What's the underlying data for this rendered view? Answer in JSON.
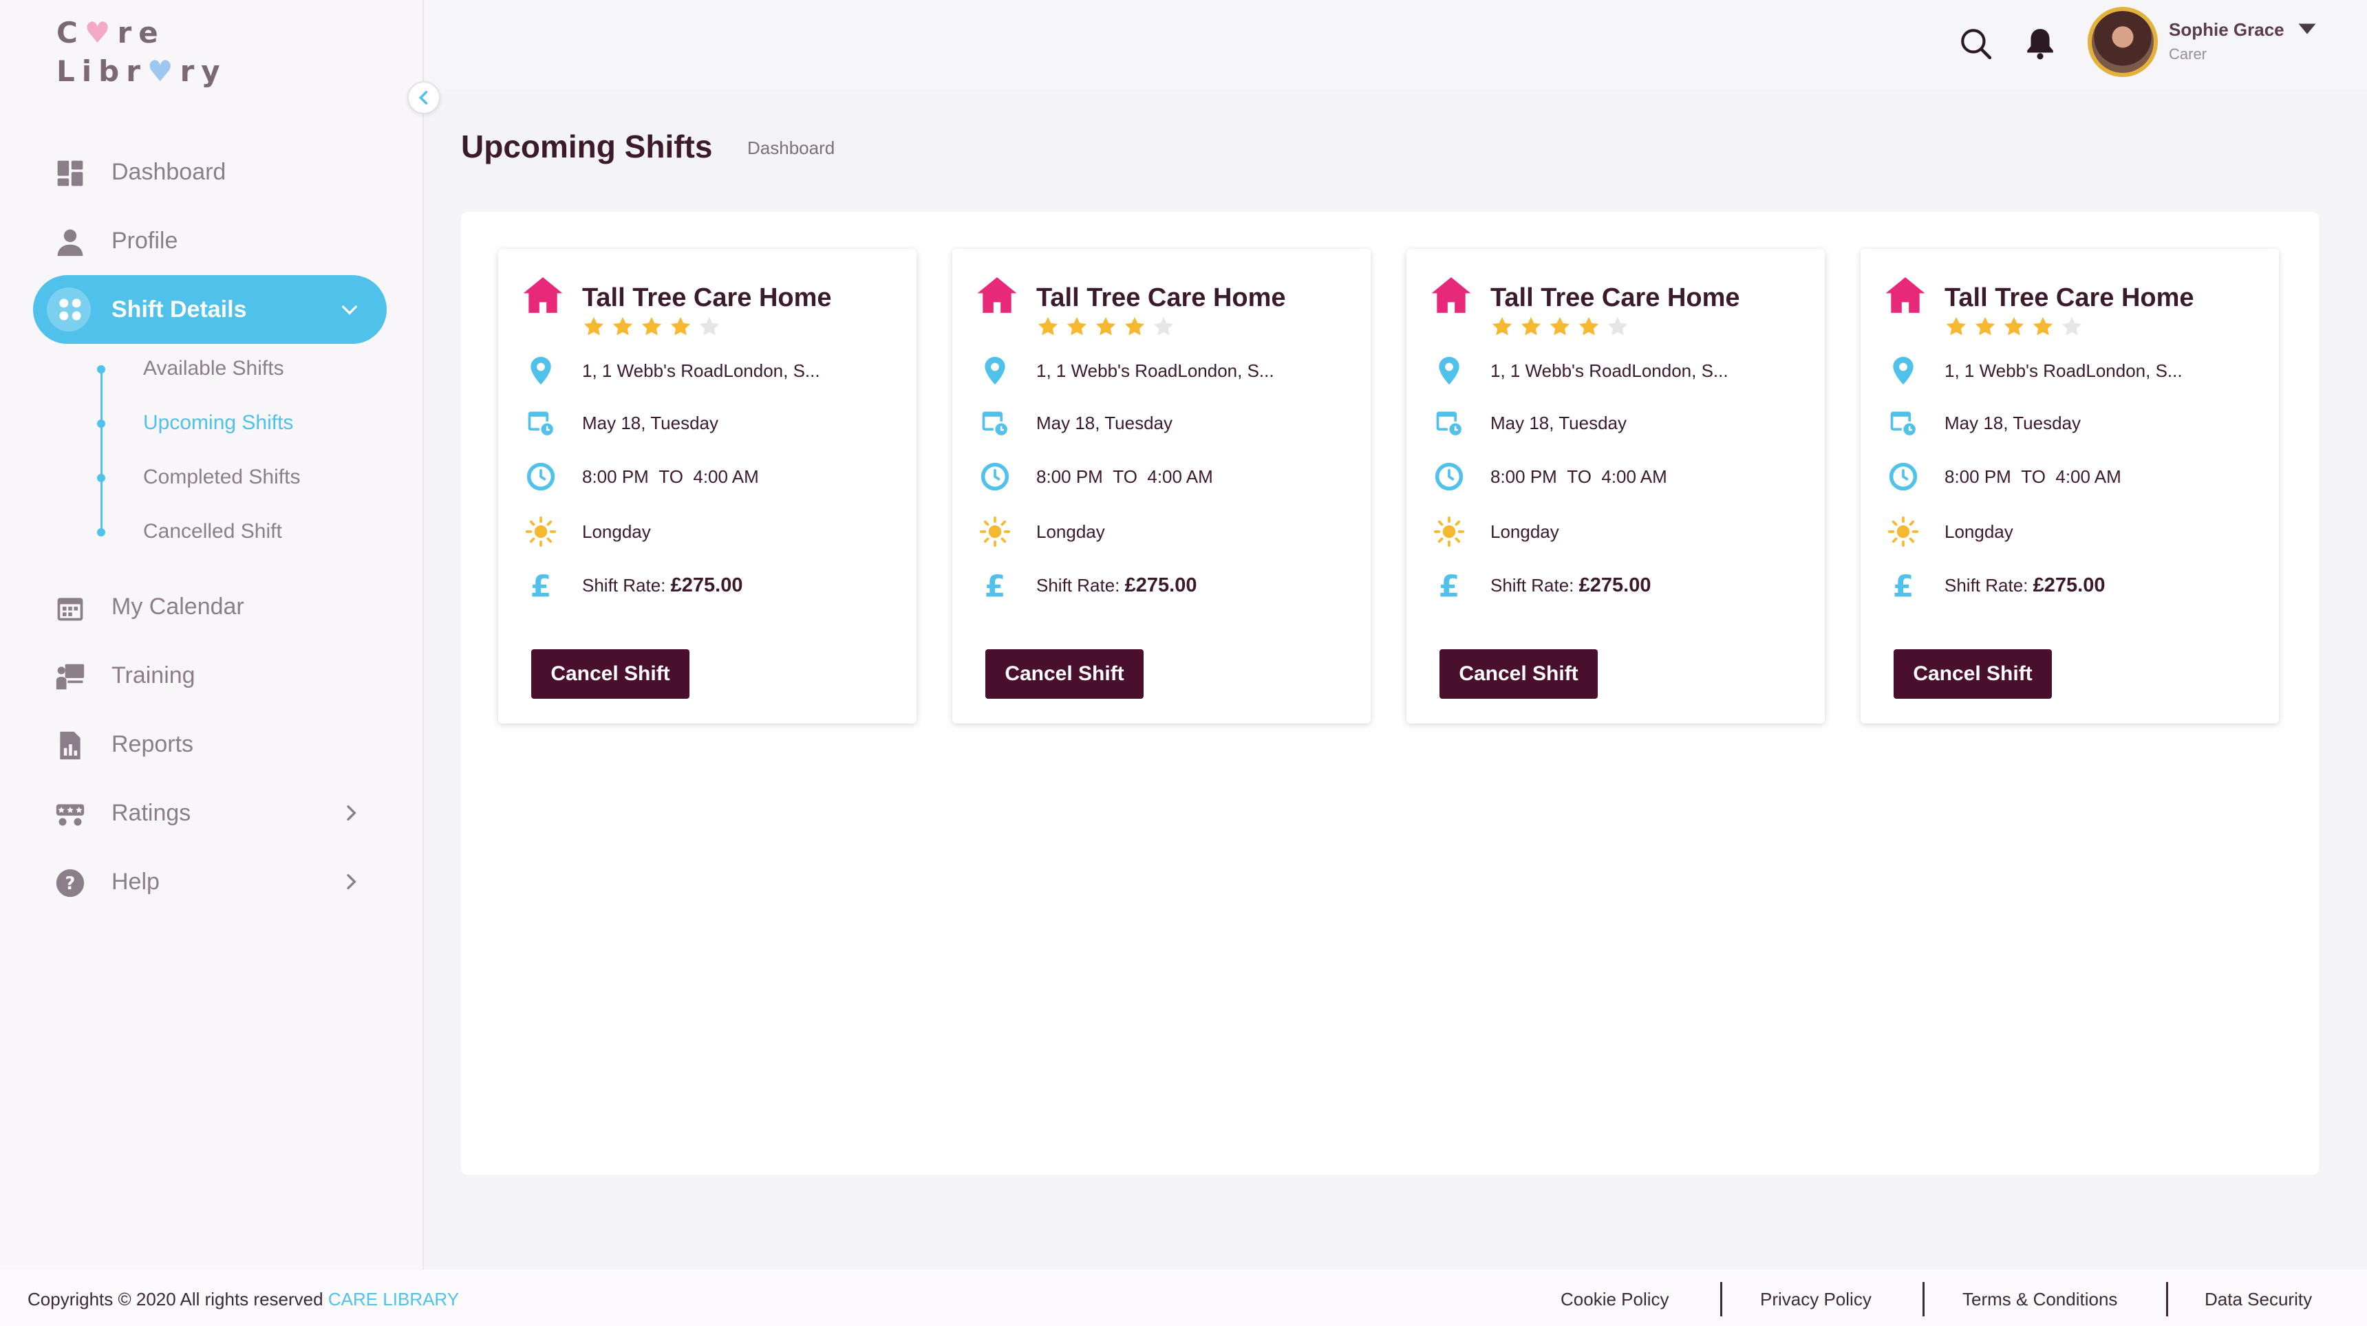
{
  "app": {
    "logo_line1": "Care",
    "logo_line2": "Library"
  },
  "sidebar": {
    "items": [
      {
        "label": "Dashboard",
        "icon": "dashboard-icon"
      },
      {
        "label": "Profile",
        "icon": "profile-icon"
      },
      {
        "label": "Shift Details",
        "icon": "shift-details-icon",
        "active": true
      },
      {
        "label": "My Calendar",
        "icon": "calendar-icon"
      },
      {
        "label": "Training",
        "icon": "training-icon"
      },
      {
        "label": "Reports",
        "icon": "reports-icon"
      },
      {
        "label": "Ratings",
        "icon": "ratings-icon"
      },
      {
        "label": "Help",
        "icon": "help-icon"
      }
    ],
    "subitems": [
      {
        "label": "Available Shifts"
      },
      {
        "label": "Upcoming Shifts",
        "current": true
      },
      {
        "label": "Completed Shifts"
      },
      {
        "label": "Cancelled Shift"
      }
    ]
  },
  "header": {
    "user_name": "Sophie Grace",
    "user_role": "Carer"
  },
  "page": {
    "title": "Upcoming Shifts",
    "breadcrumb": "Dashboard"
  },
  "cards": [
    {
      "name": "Tall Tree Care Home",
      "rating": 4,
      "address": "1, 1 Webb's RoadLondon, S...",
      "date": "May 18, Tuesday",
      "time_from": "8:00 PM",
      "time_to_word": "TO",
      "time_to": "4:00 AM",
      "shift_type": "Longday",
      "rate_label": "Shift Rate:",
      "rate_value": "£275.00",
      "button": "Cancel Shift"
    },
    {
      "name": "Tall Tree Care Home",
      "rating": 4,
      "address": "1, 1 Webb's RoadLondon, S...",
      "date": "May 18, Tuesday",
      "time_from": "8:00 PM",
      "time_to_word": "TO",
      "time_to": "4:00 AM",
      "shift_type": "Longday",
      "rate_label": "Shift Rate:",
      "rate_value": "£275.00",
      "button": "Cancel Shift"
    },
    {
      "name": "Tall Tree Care Home",
      "rating": 4,
      "address": "1, 1 Webb's RoadLondon, S...",
      "date": "May 18, Tuesday",
      "time_from": "8:00 PM",
      "time_to_word": "TO",
      "time_to": "4:00 AM",
      "shift_type": "Longday",
      "rate_label": "Shift Rate:",
      "rate_value": "£275.00",
      "button": "Cancel Shift"
    },
    {
      "name": "Tall Tree Care Home",
      "rating": 4,
      "address": "1, 1 Webb's RoadLondon, S...",
      "date": "May 18, Tuesday",
      "time_from": "8:00 PM",
      "time_to_word": "TO",
      "time_to": "4:00 AM",
      "shift_type": "Longday",
      "rate_label": "Shift Rate:",
      "rate_value": "£275.00",
      "button": "Cancel Shift"
    }
  ],
  "footer": {
    "copyright": "Copyrights © 2020  All rights reserved",
    "brand": "CARE LIBRARY",
    "links": [
      "Cookie Policy",
      "Privacy Policy",
      "Terms & Conditions",
      "Data Security"
    ]
  },
  "colors": {
    "accent": "#4fc1ea",
    "primary_button": "#4a0f2d",
    "home_icon": "#e8297a",
    "star": "#f5b82e",
    "star_empty": "#e6e6e6"
  }
}
